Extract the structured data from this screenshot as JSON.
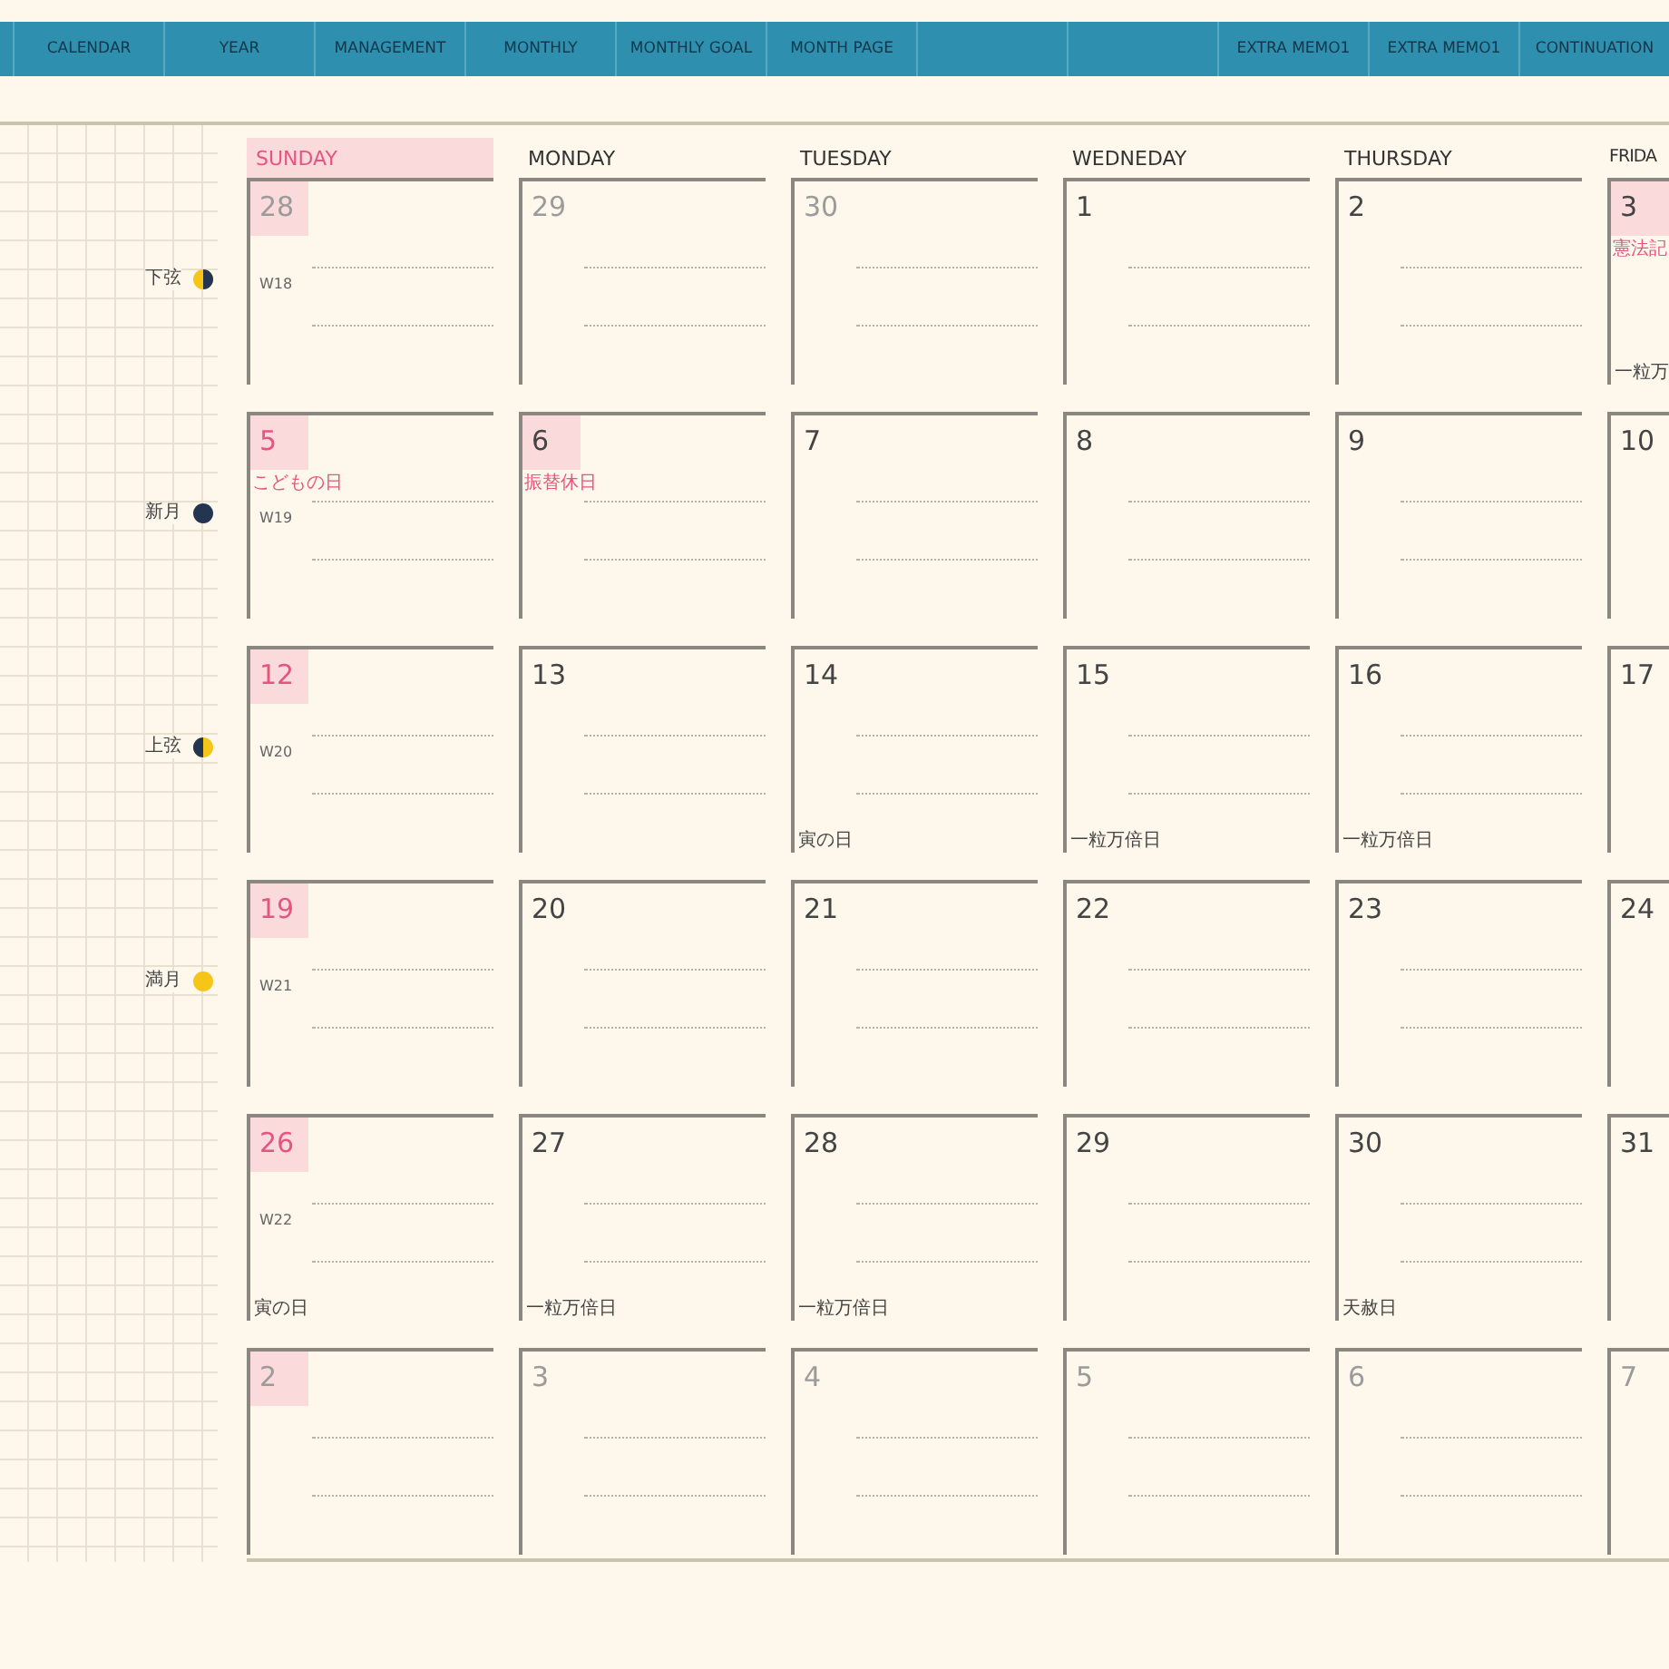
{
  "nav": {
    "tabs": [
      {
        "kind": "blank"
      },
      {
        "kind": "tab",
        "label": "CALENDAR"
      },
      {
        "kind": "tab",
        "label": "YEAR"
      },
      {
        "kind": "tab",
        "label": "MANAGEMENT"
      },
      {
        "kind": "tab",
        "label": "MONTHLY"
      },
      {
        "kind": "tab",
        "label": "MONTHLY GOAL"
      },
      {
        "kind": "tab",
        "label": "MONTH PAGE"
      },
      {
        "kind": "blank"
      },
      {
        "kind": "blank"
      },
      {
        "kind": "tab",
        "label": "EXTRA MEMO1"
      },
      {
        "kind": "tab",
        "label": "EXTRA MEMO1"
      },
      {
        "kind": "tab",
        "label": "CONTINUATION"
      }
    ]
  },
  "weekdays": [
    {
      "label": "SUNDAY",
      "highlight": true
    },
    {
      "label": "MONDAY",
      "highlight": false
    },
    {
      "label": "TUESDAY",
      "highlight": false
    },
    {
      "label": "WEDNEDAY",
      "highlight": false
    },
    {
      "label": "THURSDAY",
      "highlight": false
    },
    {
      "label": "FRIDA",
      "highlight": false
    }
  ],
  "weeks": [
    {
      "moon": {
        "label": "下弦",
        "kind": "waning"
      },
      "days": [
        {
          "date": "28",
          "muted": true,
          "red": false,
          "highlight": true,
          "week": "W18"
        },
        {
          "date": "29",
          "muted": true,
          "red": false,
          "highlight": false
        },
        {
          "date": "30",
          "muted": true,
          "red": false,
          "highlight": false
        },
        {
          "date": "1",
          "muted": false,
          "red": false,
          "highlight": false
        },
        {
          "date": "2",
          "muted": false,
          "red": false,
          "highlight": false
        },
        {
          "date": "3",
          "muted": false,
          "red": false,
          "highlight": true,
          "holiday": "憲法記",
          "note": "一粒万"
        }
      ]
    },
    {
      "moon": {
        "label": "新月",
        "kind": "new"
      },
      "days": [
        {
          "date": "5",
          "muted": false,
          "red": true,
          "highlight": true,
          "holiday": "こどもの日",
          "week": "W19"
        },
        {
          "date": "6",
          "muted": false,
          "red": false,
          "highlight": true,
          "holiday": "振替休日"
        },
        {
          "date": "7",
          "muted": false,
          "red": false,
          "highlight": false
        },
        {
          "date": "8",
          "muted": false,
          "red": false,
          "highlight": false
        },
        {
          "date": "9",
          "muted": false,
          "red": false,
          "highlight": false
        },
        {
          "date": "10",
          "muted": false,
          "red": false,
          "highlight": false
        }
      ]
    },
    {
      "moon": {
        "label": "上弦",
        "kind": "waxing"
      },
      "days": [
        {
          "date": "12",
          "muted": false,
          "red": true,
          "highlight": true,
          "week": "W20"
        },
        {
          "date": "13",
          "muted": false,
          "red": false,
          "highlight": false
        },
        {
          "date": "14",
          "muted": false,
          "red": false,
          "highlight": false,
          "note": "寅の日"
        },
        {
          "date": "15",
          "muted": false,
          "red": false,
          "highlight": false,
          "note": "一粒万倍日"
        },
        {
          "date": "16",
          "muted": false,
          "red": false,
          "highlight": false,
          "note": "一粒万倍日"
        },
        {
          "date": "17",
          "muted": false,
          "red": false,
          "highlight": false
        }
      ]
    },
    {
      "moon": {
        "label": "満月",
        "kind": "full"
      },
      "days": [
        {
          "date": "19",
          "muted": false,
          "red": true,
          "highlight": true,
          "week": "W21"
        },
        {
          "date": "20",
          "muted": false,
          "red": false,
          "highlight": false
        },
        {
          "date": "21",
          "muted": false,
          "red": false,
          "highlight": false
        },
        {
          "date": "22",
          "muted": false,
          "red": false,
          "highlight": false
        },
        {
          "date": "23",
          "muted": false,
          "red": false,
          "highlight": false
        },
        {
          "date": "24",
          "muted": false,
          "red": false,
          "highlight": false
        }
      ]
    },
    {
      "days": [
        {
          "date": "26",
          "muted": false,
          "red": true,
          "highlight": true,
          "week": "W22",
          "note": "寅の日"
        },
        {
          "date": "27",
          "muted": false,
          "red": false,
          "highlight": false,
          "note": "一粒万倍日"
        },
        {
          "date": "28",
          "muted": false,
          "red": false,
          "highlight": false,
          "note": "一粒万倍日"
        },
        {
          "date": "29",
          "muted": false,
          "red": false,
          "highlight": false
        },
        {
          "date": "30",
          "muted": false,
          "red": false,
          "highlight": false,
          "note": "天赦日"
        },
        {
          "date": "31",
          "muted": false,
          "red": false,
          "highlight": false
        }
      ]
    },
    {
      "days": [
        {
          "date": "2",
          "muted": true,
          "red": false,
          "highlight": true
        },
        {
          "date": "3",
          "muted": true,
          "red": false,
          "highlight": false
        },
        {
          "date": "4",
          "muted": true,
          "red": false,
          "highlight": false
        },
        {
          "date": "5",
          "muted": true,
          "red": false,
          "highlight": false
        },
        {
          "date": "6",
          "muted": true,
          "red": false,
          "highlight": false
        },
        {
          "date": "7",
          "muted": true,
          "red": false,
          "highlight": false
        }
      ]
    }
  ]
}
